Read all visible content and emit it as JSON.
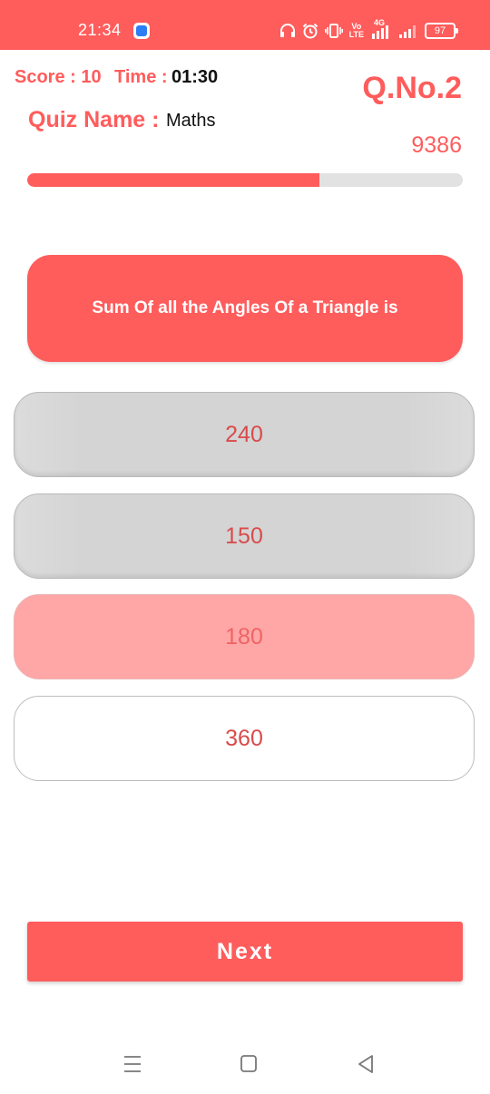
{
  "status_bar": {
    "time": "21:34",
    "battery": "97",
    "network": "4G",
    "volte_line1": "Vo",
    "volte_line2": "LTE"
  },
  "header": {
    "score_label": "Score : 10",
    "time_label": "Time :",
    "time_value": "01:30",
    "question_number": "Q.No.2",
    "quiz_name_label": "Quiz Name :",
    "quiz_name": "Maths",
    "question_id": "9386"
  },
  "progress": {
    "fraction": 0.67
  },
  "question": {
    "text": "Sum Of all the Angles Of a Triangle is"
  },
  "options": [
    {
      "label": "240",
      "state": "default"
    },
    {
      "label": "150",
      "state": "default"
    },
    {
      "label": "180",
      "state": "selected"
    },
    {
      "label": "360",
      "state": "unselected-white"
    }
  ],
  "next_button": {
    "label": "Next"
  },
  "colors": {
    "accent": "#ff5c5c",
    "option_grey": "#d4d4d4",
    "option_selected": "#ffa6a6",
    "progress_track": "#e2e2e2"
  },
  "icons": {
    "status": [
      "headphones-icon",
      "alarm-icon",
      "vibrate-icon",
      "volte-icon",
      "signal-4g-icon",
      "signal-icon",
      "battery-icon"
    ],
    "nav": [
      "recent-apps-icon",
      "home-icon",
      "back-icon"
    ]
  }
}
